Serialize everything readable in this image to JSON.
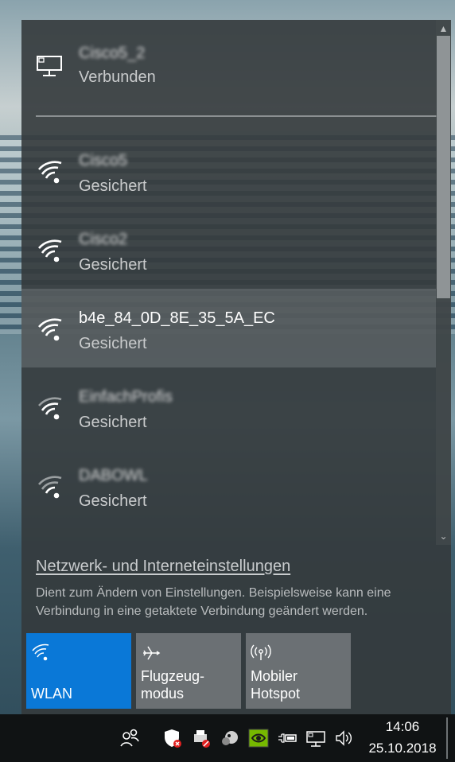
{
  "networks": [
    {
      "name": "Cisco5_2",
      "status": "Verbunden",
      "type": "ethernet",
      "blurred": true
    },
    {
      "name": "Cisco5",
      "status": "Gesichert",
      "type": "wifi",
      "blurred": true
    },
    {
      "name": "Cisco2",
      "status": "Gesichert",
      "type": "wifi",
      "blurred": true
    },
    {
      "name": "b4e_84_0D_8E_35_5A_EC",
      "status": "Gesichert",
      "type": "wifi",
      "blurred": false,
      "highlighted": true
    },
    {
      "name": "EinfachProfis",
      "status": "Gesichert",
      "type": "wifi",
      "blurred": true
    },
    {
      "name": "DABOWL",
      "status": "Gesichert",
      "type": "wifi",
      "blurred": true
    }
  ],
  "settings": {
    "link": "Netzwerk- und Interneteinstellungen",
    "description": "Dient zum Ändern von Einstellungen. Beispielsweise kann eine Verbindung in eine getaktete Verbindung geändert werden."
  },
  "quick_actions": [
    {
      "label": "WLAN",
      "icon": "wifi-icon",
      "active": true
    },
    {
      "label": "Flugzeug-\nmodus",
      "icon": "airplane-icon",
      "active": false
    },
    {
      "label": "Mobiler\nHotspot",
      "icon": "hotspot-icon",
      "active": false
    }
  ],
  "taskbar": {
    "time": "14:06",
    "date": "25.10.2018",
    "icons": [
      "people-icon",
      "security-warning-icon",
      "printer-error-icon",
      "app-icon",
      "nvidia-icon",
      "power-plug-icon",
      "battery-icon",
      "network-icon",
      "volume-icon"
    ]
  },
  "colors": {
    "accent": "#0a78d7",
    "flyout_bg": "#343a3c",
    "highlight": "#5c6264"
  }
}
